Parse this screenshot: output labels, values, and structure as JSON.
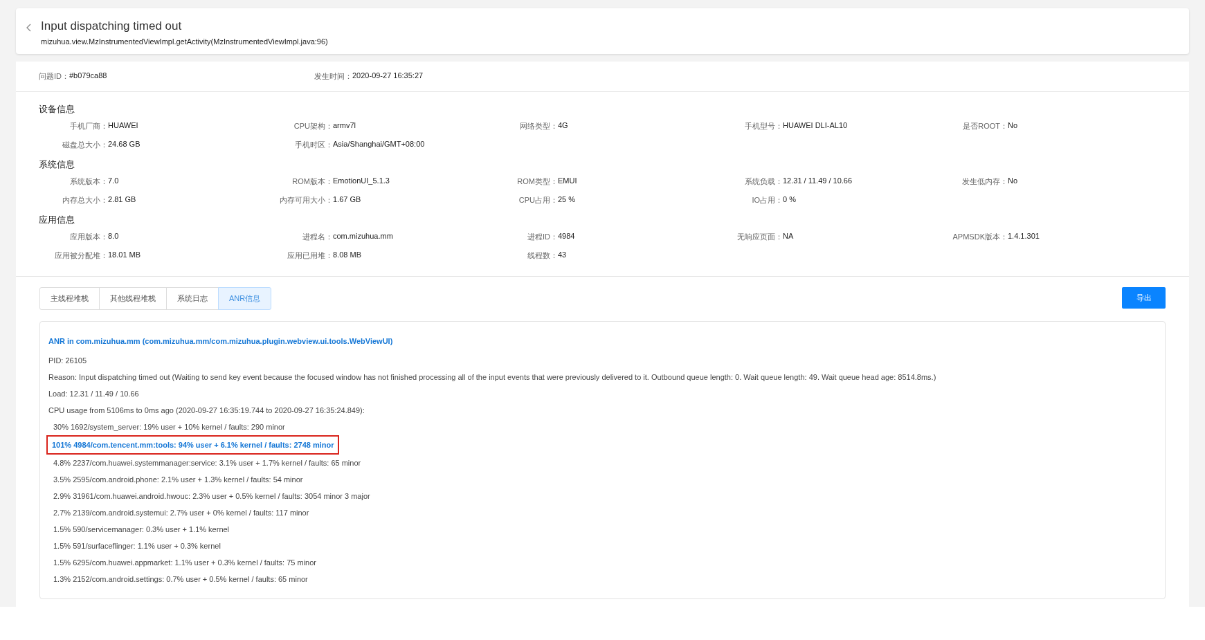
{
  "header": {
    "title": "Input dispatching timed out",
    "subtitle": "mizuhua.view.MzInstrumentedViewImpl.getActivity(MzInstrumentedViewImpl.java:96)"
  },
  "summary": [
    {
      "label": "问题ID：",
      "value": "#b079ca88"
    },
    {
      "label": "发生时间：",
      "value": "2020-09-27 16:35:27"
    }
  ],
  "sections": [
    {
      "title": "设备信息",
      "rows": [
        [
          {
            "label": "手机厂商：",
            "value": "HUAWEI"
          },
          {
            "label": "CPU架构：",
            "value": "armv7l"
          },
          {
            "label": "网络类型：",
            "value": "4G"
          },
          {
            "label": "手机型号：",
            "value": "HUAWEI DLI-AL10"
          },
          {
            "label": "是否ROOT：",
            "value": "No"
          }
        ],
        [
          {
            "label": "磁盘总大小：",
            "value": "24.68 GB"
          },
          {
            "label": "手机时区：",
            "value": "Asia/Shanghai/GMT+08:00"
          }
        ]
      ]
    },
    {
      "title": "系统信息",
      "rows": [
        [
          {
            "label": "系统版本：",
            "value": "7.0"
          },
          {
            "label": "ROM版本：",
            "value": "EmotionUI_5.1.3"
          },
          {
            "label": "ROM类型：",
            "value": "EMUI"
          },
          {
            "label": "系统负载：",
            "value": "12.31 / 11.49 / 10.66"
          },
          {
            "label": "发生低内存：",
            "value": "No"
          }
        ],
        [
          {
            "label": "内存总大小：",
            "value": "2.81 GB"
          },
          {
            "label": "内存可用大小：",
            "value": "1.67 GB"
          },
          {
            "label": "CPU占用：",
            "value": "25 %"
          },
          {
            "label": "IO占用：",
            "value": "0 %"
          }
        ]
      ]
    },
    {
      "title": "应用信息",
      "rows": [
        [
          {
            "label": "应用版本：",
            "value": "8.0"
          },
          {
            "label": "进程名：",
            "value": "com.mizuhua.mm"
          },
          {
            "label": "进程ID：",
            "value": "4984"
          },
          {
            "label": "无响应页面：",
            "value": "NA"
          },
          {
            "label": "APMSDK版本：",
            "value": "1.4.1.301"
          }
        ],
        [
          {
            "label": "应用被分配堆：",
            "value": "18.01 MB"
          },
          {
            "label": "应用已用堆：",
            "value": "8.08 MB"
          },
          {
            "label": "线程数：",
            "value": "43"
          }
        ]
      ]
    }
  ],
  "tabs": [
    {
      "label": "主线程堆栈",
      "selected": false
    },
    {
      "label": "其他线程堆栈",
      "selected": false
    },
    {
      "label": "系统日志",
      "selected": false
    },
    {
      "label": "ANR信息",
      "selected": true
    }
  ],
  "export_button": "导出",
  "log": [
    {
      "kind": "heading",
      "text": "ANR in com.mizuhua.mm (com.mizuhua.mm/com.mizuhua.plugin.webview.ui.tools.WebViewUI)"
    },
    {
      "kind": "plain",
      "text": "PID: 26105"
    },
    {
      "kind": "plain",
      "text": "Reason: Input dispatching timed out (Waiting to send key event because the focused window has not finished processing all of the input events that were previously delivered to it.  Outbound queue length: 0.  Wait queue length: 49.  Wait queue head age: 8514.8ms.)"
    },
    {
      "kind": "plain",
      "text": "Load: 12.31 / 11.49 / 10.66"
    },
    {
      "kind": "plain",
      "text": "CPU usage from 5106ms to 0ms ago (2020-09-27 16:35:19.744 to 2020-09-27 16:35:24.849):"
    },
    {
      "kind": "indent",
      "text": "30% 1692/system_server: 19% user + 10% kernel / faults: 290 minor"
    },
    {
      "kind": "highlight",
      "text": "101% 4984/com.tencent.mm:tools: 94% user + 6.1% kernel / faults: 2748 minor"
    },
    {
      "kind": "indent",
      "text": "4.8% 2237/com.huawei.systemmanager:service: 3.1% user + 1.7% kernel / faults: 65 minor"
    },
    {
      "kind": "indent",
      "text": "3.5% 2595/com.android.phone: 2.1% user + 1.3% kernel / faults: 54 minor"
    },
    {
      "kind": "indent",
      "text": "2.9% 31961/com.huawei.android.hwouc: 2.3% user + 0.5% kernel / faults: 3054 minor 3 major"
    },
    {
      "kind": "indent",
      "text": "2.7% 2139/com.android.systemui: 2.7% user + 0% kernel / faults: 117 minor"
    },
    {
      "kind": "indent",
      "text": "1.5% 590/servicemanager: 0.3% user + 1.1% kernel"
    },
    {
      "kind": "indent",
      "text": "1.5% 591/surfaceflinger: 1.1% user + 0.3% kernel"
    },
    {
      "kind": "indent",
      "text": "1.5% 6295/com.huawei.appmarket: 1.1% user + 0.3% kernel / faults: 75 minor"
    },
    {
      "kind": "indent",
      "text": "1.3% 2152/com.android.settings: 0.7% user + 0.5% kernel / faults: 65 minor"
    }
  ]
}
